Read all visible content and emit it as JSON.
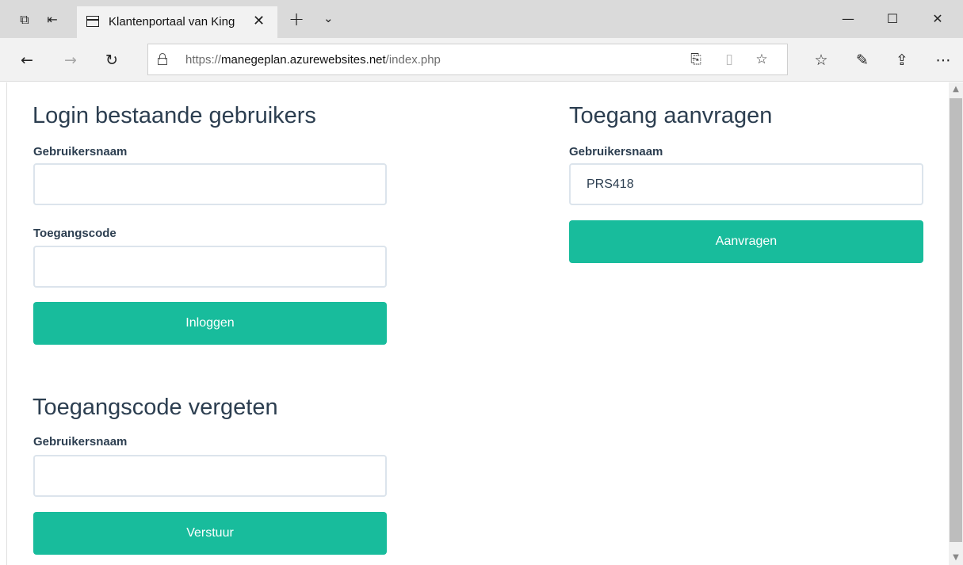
{
  "browser": {
    "tab_title": "Klantenportaal van King",
    "url_scheme": "https://",
    "url_host": "manegeplan.azurewebsites.net",
    "url_path": "/index.php",
    "icons": [
      "tab-preview-icon",
      "set-aside-tabs-icon",
      "page-icon",
      "close-icon",
      "new-tab-icon",
      "tab-list-chevron-icon",
      "minimize-icon",
      "maximize-icon",
      "close-window-icon",
      "back-icon",
      "forward-icon",
      "refresh-icon",
      "lock-icon",
      "add-notes-icon",
      "reading-view-icon",
      "favorite-star-icon",
      "favorites-hub-icon",
      "pen-icon",
      "share-icon",
      "more-icon"
    ]
  },
  "login": {
    "heading": "Login bestaande gebruikers",
    "username_label": "Gebruikersnaam",
    "username_value": "",
    "code_label": "Toegangscode",
    "code_value": "",
    "submit_label": "Inloggen"
  },
  "request": {
    "heading": "Toegang aanvragen",
    "username_label": "Gebruikersnaam",
    "username_value": "PRS418",
    "submit_label": "Aanvragen"
  },
  "forgot": {
    "heading": "Toegangscode vergeten",
    "username_label": "Gebruikersnaam",
    "username_value": "",
    "submit_label": "Verstuur"
  },
  "colors": {
    "accent": "#18bc9c",
    "text": "#2c3e50",
    "input_border": "#dce4ec"
  }
}
